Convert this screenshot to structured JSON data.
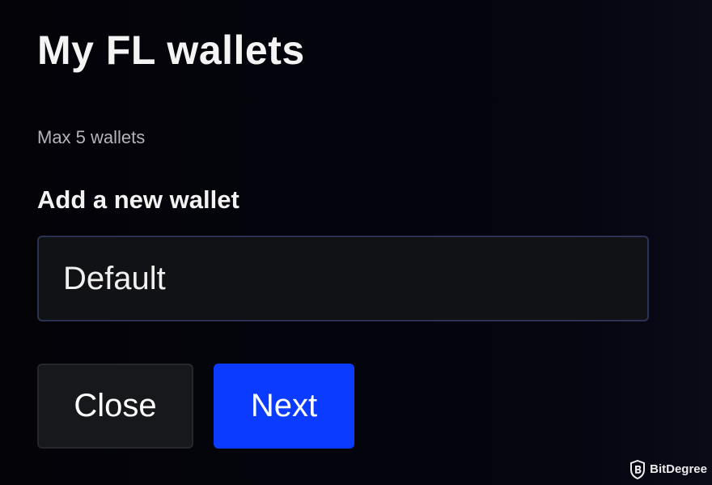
{
  "dialog": {
    "title": "My FL wallets",
    "subtitle": "Max 5 wallets",
    "field_label": "Add a new wallet",
    "wallet_name_value": "Default"
  },
  "actions": {
    "close_label": "Close",
    "next_label": "Next"
  },
  "watermark": {
    "brand": "BitDegree",
    "icon": "bitdegree-shield-logo"
  },
  "colors": {
    "background": "#04040a",
    "input_background": "#111216",
    "input_border": "#2b3352",
    "close_button": "#17181c",
    "next_button": "#0a3bff"
  }
}
